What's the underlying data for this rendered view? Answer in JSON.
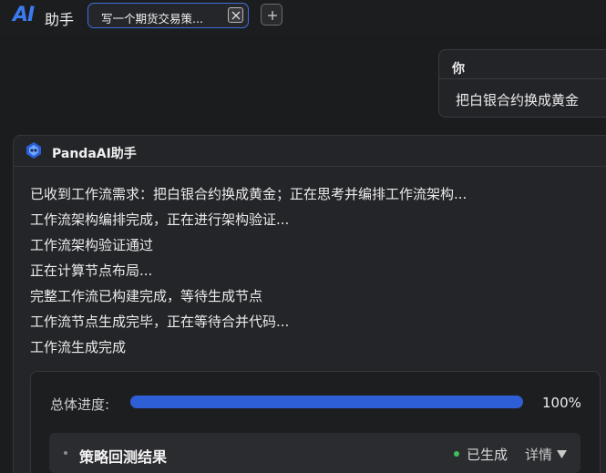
{
  "app": {
    "logo": "AI",
    "name": "助手"
  },
  "tabs": [
    {
      "label": "写一个期货交易策...",
      "active": true
    }
  ],
  "icons": {
    "tab_close": "close-icon",
    "add_tab": "plus-icon",
    "assistant_avatar": "panda-logo-icon",
    "details_caret": "caret-down-icon"
  },
  "colors": {
    "accent": "#3b7bf0",
    "progress": "#2f5fd6",
    "status_success": "#3fbf5a"
  },
  "user_message": {
    "sender": "你",
    "text": "把白银合约换成黄金"
  },
  "assistant_message": {
    "sender": "PandaAI助手",
    "lines": [
      "已收到工作流需求：把白银合约换成黄金；正在思考并编排工作流架构...",
      "工作流架构编排完成，正在进行架构验证...",
      "工作流架构验证通过",
      "正在计算节点布局...",
      "完整工作流已构建完成，等待生成节点",
      "工作流节点生成完毕，正在等待合并代码...",
      "工作流生成完成"
    ]
  },
  "progress": {
    "label": "总体进度:",
    "value": 100,
    "text": "100%"
  },
  "node": {
    "title": "策略回测结果",
    "status": "已生成",
    "details_label": "详情"
  }
}
